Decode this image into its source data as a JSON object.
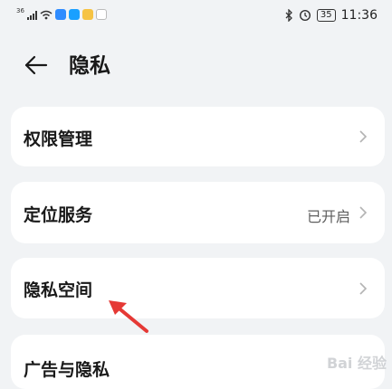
{
  "status_bar": {
    "network_label": "36",
    "battery": "35",
    "time": "11:36",
    "icons": [
      "signal-icon",
      "wifi-icon",
      "app-icon",
      "app-icon",
      "app-icon",
      "app-icon",
      "bluetooth-icon",
      "alarm-icon",
      "battery-icon"
    ]
  },
  "header": {
    "back_icon": "back-arrow-icon",
    "title": "隐私"
  },
  "settings": [
    {
      "label": "权限管理",
      "value": ""
    },
    {
      "label": "定位服务",
      "value": "已开启"
    },
    {
      "label": "隐私空间",
      "value": ""
    },
    {
      "label": "广告与隐私",
      "value": ""
    }
  ],
  "annotation": {
    "color": "#e53935"
  },
  "watermark": "Bai 经验",
  "colors": {
    "background": "#f1f3f5",
    "card": "#ffffff",
    "text": "#191919",
    "secondary": "#5e5e5e"
  }
}
